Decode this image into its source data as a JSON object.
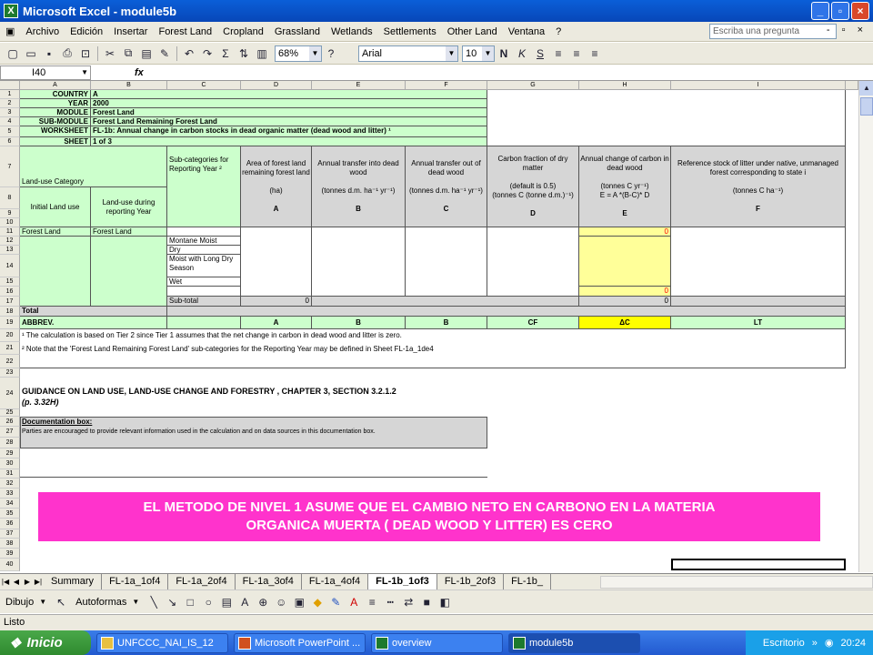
{
  "window": {
    "title": "Microsoft Excel - module5b"
  },
  "menu": [
    "Archivo",
    "Edición",
    "Insertar",
    "Forest Land",
    "Cropland",
    "Grassland",
    "Wetlands",
    "Settlements",
    "Other Land",
    "Ventana",
    "?"
  ],
  "menu_ask": "Escriba una pregunta",
  "toolbar": {
    "zoom": "68%",
    "font": "Arial",
    "size": "10"
  },
  "formula": {
    "cell": "I40",
    "fx": "fx"
  },
  "columns": [
    "A",
    "B",
    "C",
    "D",
    "E",
    "F",
    "G",
    "H",
    "I"
  ],
  "sheet": {
    "country_label": "COUNTRY",
    "country": "A",
    "year_label": "YEAR",
    "year": "2000",
    "module_label": "MODULE",
    "module": "Forest Land",
    "submodule_label": "SUB-MODULE",
    "submodule": "Forest Land Remaining Forest Land",
    "worksheet_label": "WORKSHEET",
    "worksheet": "FL-1b:  Annual change in carbon stocks in dead organic matter (dead wood and litter) ¹",
    "sheet_label": "SHEET",
    "sheet": "1 of 3",
    "luc": "Land-use Category",
    "initial": "Initial Land use",
    "during": "Land-use during reporting Year",
    "subcat": "Sub-categories for Reporting Year ²",
    "d_head": "Area of forest land remaining forest land",
    "d_unit": "(ha)",
    "d_letter": "A",
    "e_head": "Annual transfer into dead wood",
    "e_unit": "(tonnes d.m. ha⁻¹ yr⁻¹)",
    "e_letter": "B",
    "f_head": "Annual transfer out of dead wood",
    "f_unit": "(tonnes d.m. ha⁻¹ yr⁻¹)",
    "f_letter": "C",
    "g_head": "Carbon fraction of dry matter",
    "g_unit": "(default is 0.5)",
    "g_unit2": "(tonnes C (tonne d.m.)⁻¹)",
    "g_letter": "D",
    "h_head": "Annual change of carbon in dead wood",
    "h_unit": "(tonnes C yr⁻¹)",
    "h_formula": "E = A *(B-C)* D",
    "h_letter": "E",
    "i_head": "Reference stock of litter under native, unmanaged forest corresponding to state i",
    "i_unit": "(tonnes C ha⁻¹)",
    "i_letter": "F",
    "r11a": "Forest Land",
    "r11b": "Forest Land",
    "r11h": "0",
    "sub1": "Montane Moist",
    "sub2": "Dry",
    "sub3": "Moist with Long Dry Season",
    "sub4": "Wet",
    "r16h": "0",
    "subtotal": "Sub-total",
    "subtotal_d": "0",
    "subtotal_h": "0",
    "total": "Total",
    "abbrev": "ABBREV.",
    "ab_a": "A",
    "ab_b": "B",
    "ab_c": "B",
    "ab_cf": "CF",
    "ab_e": "ΔC",
    "ab_f": "LT",
    "note1": "¹ The calculation is based on Tier 2 since Tier 1 assumes that the net change in carbon in dead wood and litter is zero.",
    "note2": "² Note that the 'Forest Land Remaining Forest Land' sub-categories for the Reporting Year may be defined in Sheet FL-1a_1de4",
    "guidance1": "GUIDANCE ON LAND USE, LAND-USE CHANGE AND FORESTRY , CHAPTER 3, SECTION 3.2.1.2",
    "guidance2": "(p. 3.32H)",
    "doc_label": "Documentation box:",
    "doc_text": "Parties are encouraged to provide relevant information used in the calculation and on data sources in this documentation box."
  },
  "banner": {
    "line1": "EL METODO DE NIVEL 1 ASUME QUE EL CAMBIO NETO EN CARBONO EN LA MATERIA",
    "line2": "ORGANICA MUERTA ( DEAD WOOD Y LITTER) ES CERO"
  },
  "tabs": [
    "Summary",
    "FL-1a_1of4",
    "FL-1a_2of4",
    "FL-1a_3of4",
    "FL-1a_4of4",
    "FL-1b_1of3",
    "FL-1b_2of3",
    "FL-1b_"
  ],
  "drawbar": {
    "dibujo": "Dibujo",
    "autoformas": "Autoformas"
  },
  "status": "Listo",
  "taskbar": {
    "start": "Inicio",
    "items": [
      "UNFCCC_NAI_IS_12",
      "Microsoft PowerPoint ...",
      "overview",
      "module5b"
    ],
    "desk": "Escritorio",
    "clock": "20:24"
  }
}
